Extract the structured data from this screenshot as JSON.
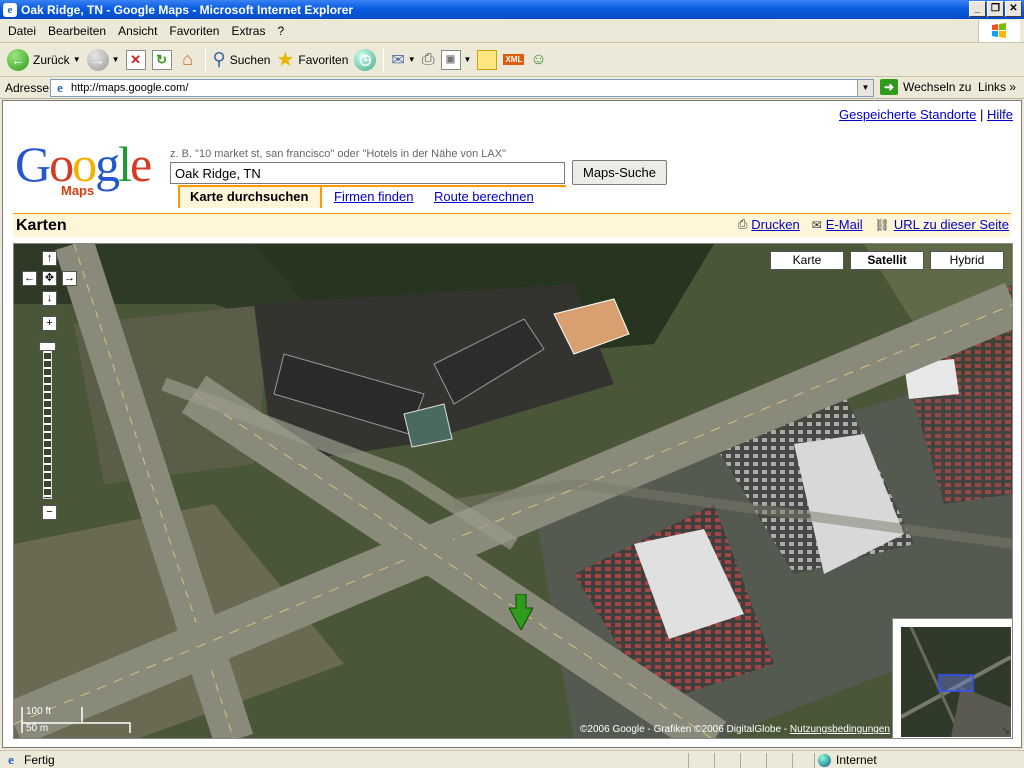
{
  "window": {
    "title": "Oak Ridge, TN - Google Maps - Microsoft Internet Explorer",
    "app_icon": "ie-icon"
  },
  "menu": [
    "Datei",
    "Bearbeiten",
    "Ansicht",
    "Favoriten",
    "Extras",
    "?"
  ],
  "toolbar": {
    "back": "Zurück",
    "search": "Suchen",
    "favorites": "Favoriten"
  },
  "address": {
    "label": "Adresse",
    "url": "http://maps.google.com/",
    "go": "Wechseln zu",
    "links": "Links"
  },
  "page": {
    "top_links": {
      "saved": "Gespeicherte Standorte",
      "sep": "|",
      "help": "Hilfe"
    },
    "logo": {
      "google": "Google",
      "maps": "Maps"
    },
    "hint": "z. B. \"10 market st, san francisco\" oder \"Hotels in der Nähe von LAX\"",
    "search_value": "Oak Ridge, TN",
    "search_button": "Maps-Suche",
    "tabs": {
      "browse": "Karte durchsuchen",
      "find": "Firmen finden",
      "route": "Route berechnen"
    },
    "section_title": "Karten",
    "tools": {
      "print": "Drucken",
      "email": "E-Mail",
      "url": "URL zu dieser Seite"
    },
    "map": {
      "types": {
        "map": "Karte",
        "satellite": "Satellit",
        "hybrid": "Hybrid"
      },
      "active_type": "Satellit",
      "scale": {
        "ft": "100 ft",
        "m": "50 m"
      },
      "copyright": "©2006 Google - Grafiken ©2006 DigitalGlobe - ",
      "terms": "Nutzungsbedingungen"
    }
  },
  "status": {
    "text": "Fertig",
    "zone": "Internet"
  },
  "colors": {
    "titlebar": "#0a5ddf",
    "accent": "#ff9900",
    "tabbg": "#fff5d8",
    "marker": "#2f9a1b"
  }
}
